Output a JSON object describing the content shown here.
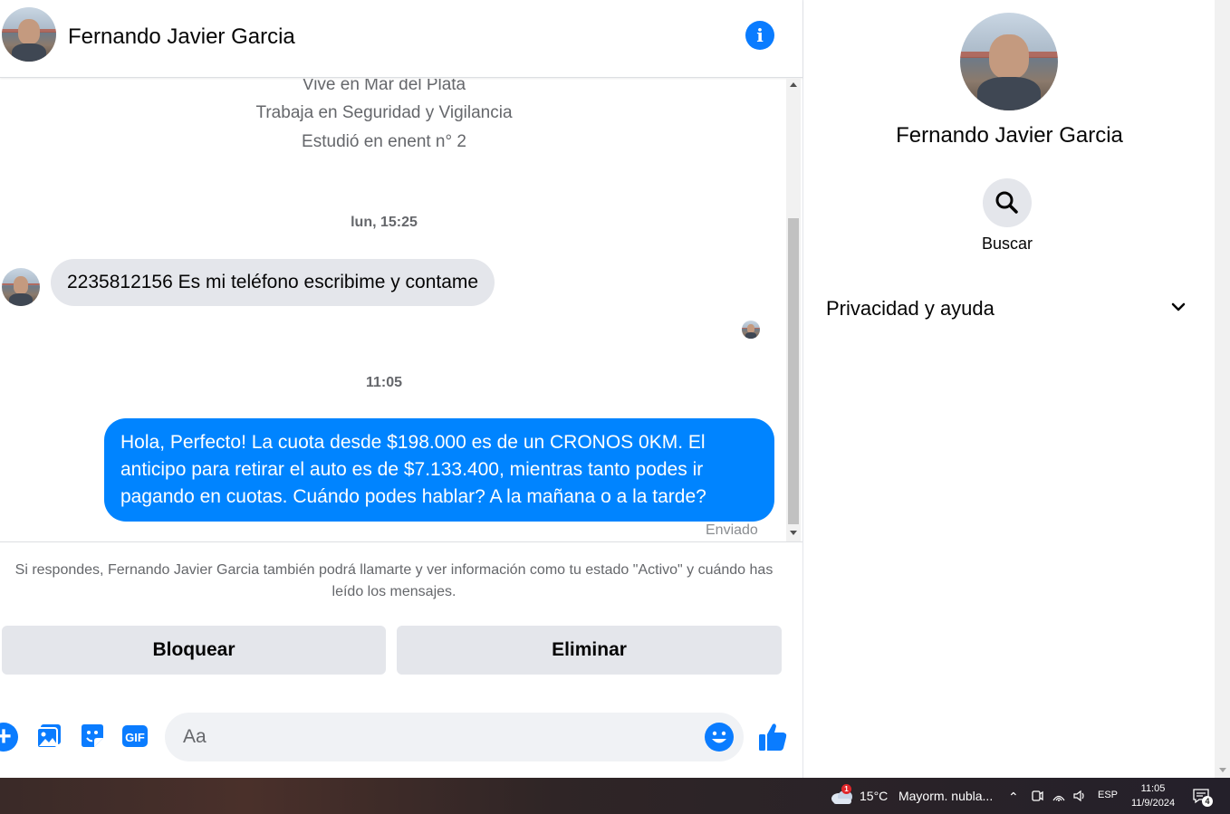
{
  "header": {
    "contact_name": "Fernando Javier Garcia"
  },
  "bio": {
    "lives": "Vive en Mar del Plata",
    "works": "Trabaja en Seguridad y Vigilancia",
    "studied": "Estudió en enent n° 2"
  },
  "messages": {
    "timestamp_1": "lun, 15:25",
    "incoming_text": "2235812156 Es mi teléfono escribime  y contame",
    "timestamp_2": "11:05",
    "outgoing_text": "Hola, Perfecto! La cuota desde $198.000 es de un CRONOS 0KM. El anticipo para retirar el auto es de $7.133.400, mientras tanto podes ir pagando en cuotas. Cuándo podes hablar? A la mañana o a la tarde?",
    "status": "Enviado"
  },
  "request": {
    "notice": "Si respondes, Fernando Javier Garcia también podrá llamarte y ver información como tu estado \"Activo\" y cuándo has leído los mensajes.",
    "block_label": "Bloquear",
    "delete_label": "Eliminar"
  },
  "composer": {
    "placeholder": "Aa",
    "icons": [
      "plus-icon",
      "image-icon",
      "sticker-icon",
      "gif-icon",
      "emoji-icon",
      "like-icon"
    ]
  },
  "side_panel": {
    "name": "Fernando Javier Garcia",
    "search_label": "Buscar",
    "privacy_label": "Privacidad y ayuda"
  },
  "taskbar": {
    "temperature": "15°C",
    "weather": "Mayorm. nubla...",
    "weather_badge": "1",
    "language": "ESP",
    "time": "11:05",
    "date": "11/9/2024",
    "notifications": "4"
  },
  "colors": {
    "accent": "#0084ff",
    "icon_blue": "#0a7cff",
    "bubble_in": "#e4e6eb"
  }
}
